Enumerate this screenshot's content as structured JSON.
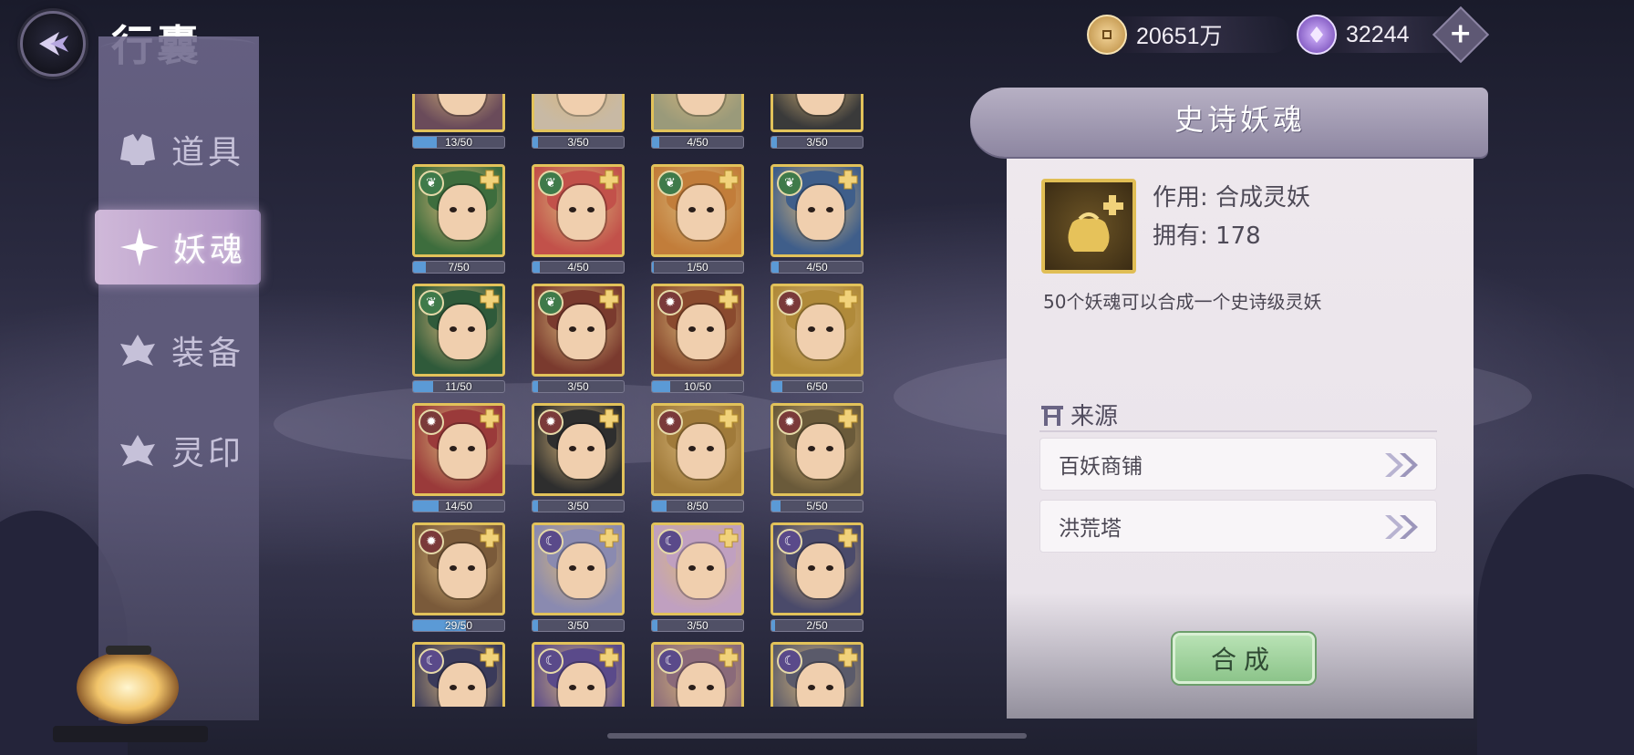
{
  "header": {
    "title": "行囊",
    "back_icon": "back-arrow-icon"
  },
  "currencies": [
    {
      "icon": "coin-icon",
      "value": "20651万",
      "color": "#d9a95a"
    },
    {
      "icon": "crystal-icon",
      "value": "32244",
      "color": "#9a6fd6"
    }
  ],
  "plus_symbol": "+",
  "sidebar": {
    "items": [
      {
        "label": "道具",
        "icon": "robe-icon",
        "active": false
      },
      {
        "label": "妖魂",
        "icon": "sparkle-icon",
        "active": true
      },
      {
        "label": "装备",
        "icon": "armor-icon",
        "active": false
      },
      {
        "label": "灵印",
        "icon": "seal-icon",
        "active": false
      }
    ]
  },
  "grid": {
    "rows": [
      [
        {
          "count": "13/50",
          "progress": 0.26,
          "faction": "",
          "theme": "#6a4b5a"
        },
        {
          "count": "3/50",
          "progress": 0.06,
          "faction": "",
          "theme": "#c8b9a4"
        },
        {
          "count": "4/50",
          "progress": 0.08,
          "faction": "",
          "theme": "#9a9a7a"
        },
        {
          "count": "3/50",
          "progress": 0.06,
          "faction": "",
          "theme": "#3a3a3a"
        }
      ],
      [
        {
          "count": "7/50",
          "progress": 0.14,
          "faction": "leaf",
          "theme": "#3d6d3d"
        },
        {
          "count": "4/50",
          "progress": 0.08,
          "faction": "leaf",
          "theme": "#c2514a"
        },
        {
          "count": "1/50",
          "progress": 0.02,
          "faction": "leaf",
          "theme": "#c27d3a"
        },
        {
          "count": "4/50",
          "progress": 0.08,
          "faction": "leaf",
          "theme": "#3f5e8a"
        }
      ],
      [
        {
          "count": "11/50",
          "progress": 0.22,
          "faction": "leaf",
          "theme": "#2f5a3a"
        },
        {
          "count": "3/50",
          "progress": 0.06,
          "faction": "leaf",
          "theme": "#7a3a2e"
        },
        {
          "count": "10/50",
          "progress": 0.2,
          "faction": "sun",
          "theme": "#8a4a2e"
        },
        {
          "count": "6/50",
          "progress": 0.12,
          "faction": "sun",
          "theme": "#b08a3a"
        }
      ],
      [
        {
          "count": "14/50",
          "progress": 0.28,
          "faction": "sun",
          "theme": "#9a3a3a"
        },
        {
          "count": "3/50",
          "progress": 0.06,
          "faction": "sun",
          "theme": "#2e2e2e"
        },
        {
          "count": "8/50",
          "progress": 0.16,
          "faction": "sun",
          "theme": "#a07a3a"
        },
        {
          "count": "5/50",
          "progress": 0.1,
          "faction": "sun",
          "theme": "#6a5a3a"
        }
      ],
      [
        {
          "count": "29/50",
          "progress": 0.58,
          "faction": "sun",
          "theme": "#7a5a3a"
        },
        {
          "count": "3/50",
          "progress": 0.06,
          "faction": "moon",
          "theme": "#8a8ab0"
        },
        {
          "count": "3/50",
          "progress": 0.06,
          "faction": "moon",
          "theme": "#c0a0c0"
        },
        {
          "count": "2/50",
          "progress": 0.04,
          "faction": "moon",
          "theme": "#4a4a6a"
        }
      ],
      [
        {
          "count": "",
          "progress": 0,
          "faction": "moon",
          "theme": "#3a3a5a"
        },
        {
          "count": "",
          "progress": 0,
          "faction": "moon",
          "theme": "#5a4a8a"
        },
        {
          "count": "",
          "progress": 0,
          "faction": "moon",
          "theme": "#8a6a7a"
        },
        {
          "count": "",
          "progress": 0,
          "faction": "moon",
          "theme": "#5a5a6a"
        }
      ]
    ]
  },
  "detail": {
    "title": "史诗妖魂",
    "item_icon": "soul-bag-icon",
    "effect_label": "作用:",
    "effect_value": "合成灵妖",
    "owned_label": "拥有:",
    "owned_value": "178",
    "description": "50个妖魂可以合成一个史诗级灵妖",
    "source_heading": "来源",
    "source_icon": "gate-icon",
    "sources": [
      {
        "label": "百妖商铺",
        "icon": "double-chevron-right-icon"
      },
      {
        "label": "洪荒塔",
        "icon": "double-chevron-right-icon"
      }
    ],
    "compose_button": "合成"
  }
}
